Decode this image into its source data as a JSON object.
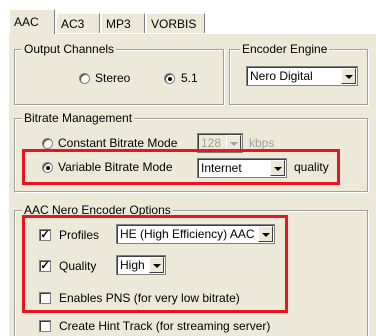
{
  "tabs": [
    "AAC",
    "AC3",
    "MP3",
    "VORBIS"
  ],
  "output_channels": {
    "title": "Output Channels",
    "options": [
      "Stereo",
      "5.1"
    ],
    "selected": "5.1"
  },
  "encoder_engine": {
    "title": "Encoder Engine",
    "value": "Nero Digital"
  },
  "bitrate": {
    "title": "Bitrate Management",
    "cbr_label": "Constant Bitrate Mode",
    "cbr_value": "128",
    "cbr_unit": "kbps",
    "vbr_label": "Variable Bitrate Mode",
    "vbr_value": "Internet",
    "vbr_unit": "quality",
    "selected": "Variable Bitrate Mode"
  },
  "nero": {
    "title": "AAC Nero Encoder Options",
    "profiles_label": "Profiles",
    "profiles_value": "HE (High Efficiency) AAC",
    "quality_label": "Quality",
    "quality_value": "High",
    "pns_label": "Enables PNS (for very low bitrate)"
  },
  "hint_track_label": "Create Hint Track (for streaming server)",
  "colors": {
    "panel": "#ece9d8",
    "highlight": "#e8141e"
  }
}
